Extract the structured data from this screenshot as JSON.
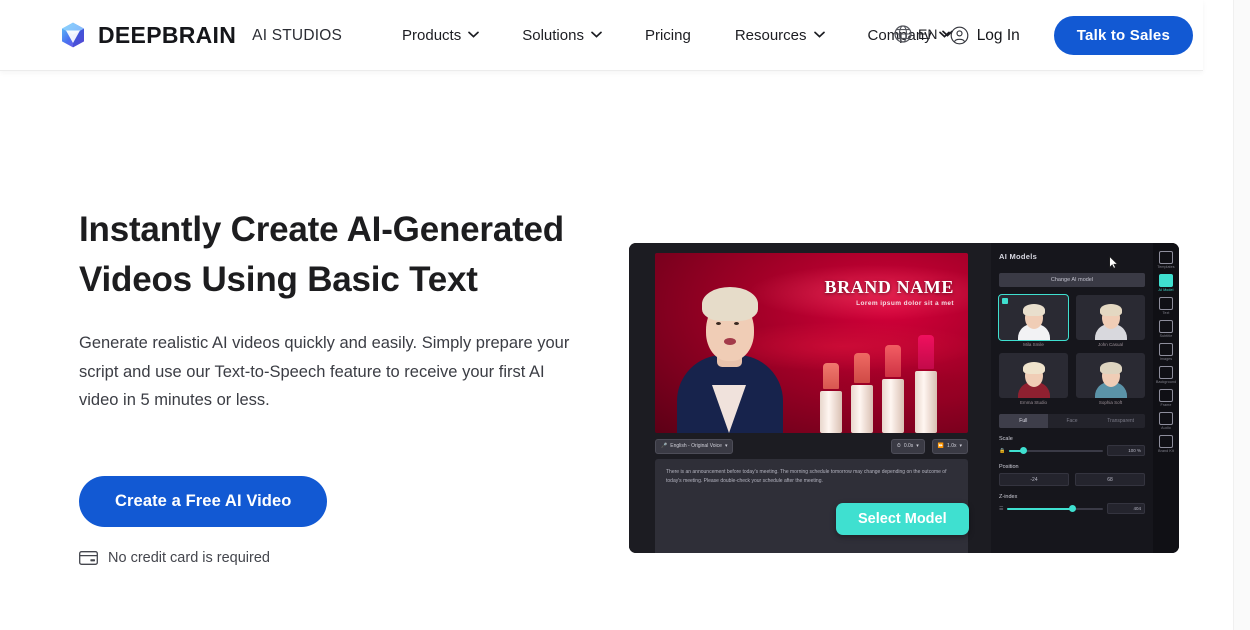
{
  "header": {
    "brand": {
      "name": "DEEPBRAIN",
      "suffix": "AI STUDIOS",
      "logo_icon": "cube-logo-icon"
    },
    "nav": [
      {
        "label": "Products",
        "has_dropdown": true
      },
      {
        "label": "Solutions",
        "has_dropdown": true
      },
      {
        "label": "Pricing",
        "has_dropdown": false
      },
      {
        "label": "Resources",
        "has_dropdown": true
      },
      {
        "label": "Company",
        "has_dropdown": true
      }
    ],
    "language": {
      "label": "EN",
      "icon": "globe-icon"
    },
    "login": {
      "label": "Log In",
      "icon": "user-circle-icon"
    },
    "cta": {
      "label": "Talk to Sales"
    }
  },
  "hero": {
    "heading": "Instantly Create AI-Generated Videos Using Basic Text",
    "paragraph": "Generate realistic AI videos quickly and easily. Simply prepare your script and use our Text-to-Speech feature to receive your first AI video in 5 minutes or less.",
    "cta_label": "Create a Free AI Video",
    "note": "No credit card is required",
    "note_icon": "credit-card-icon"
  },
  "mockup": {
    "video": {
      "brand_title": "BRAND NAME",
      "brand_subtitle": "Lorem ipsum dolor sit a met"
    },
    "toolbar": {
      "language_pill": "English - Original Voice",
      "duration": "0.0s",
      "speed": "1.0x"
    },
    "script": "There is an announcement before today's meeting. The morning schedule tomorrow may change depending on the outcome of today's meeting. Please double-check your schedule after the meeting.",
    "select_model_label": "Select Model",
    "panel": {
      "title": "AI Models",
      "change_button": "Change AI model",
      "avatars": [
        {
          "label": "Mila Smile",
          "selected": true
        },
        {
          "label": "John Casual",
          "selected": false
        },
        {
          "label": "Emma Studio",
          "selected": false
        },
        {
          "label": "Sophia Soft",
          "selected": false
        }
      ],
      "segments": [
        {
          "label": "Full",
          "active": true
        },
        {
          "label": "Face",
          "active": false
        },
        {
          "label": "Transparent",
          "active": false
        }
      ],
      "controls": [
        {
          "name": "Scale",
          "value": "100 %"
        },
        {
          "name": "Position",
          "x": "-24",
          "y": "68"
        },
        {
          "name": "Z-index",
          "value": "404"
        }
      ]
    },
    "vtools": [
      {
        "label": "Templates",
        "icon": "template-icon",
        "active": false
      },
      {
        "label": "AI Model",
        "icon": "person-icon",
        "active": true
      },
      {
        "label": "Text",
        "icon": "text-icon",
        "active": false
      },
      {
        "label": "Subtitle",
        "icon": "subtitle-icon",
        "active": false
      },
      {
        "label": "Images",
        "icon": "image-icon",
        "active": false
      },
      {
        "label": "Background",
        "icon": "background-icon",
        "active": false
      },
      {
        "label": "Frame",
        "icon": "frame-icon",
        "active": false
      },
      {
        "label": "Audio",
        "icon": "audio-icon",
        "active": false
      },
      {
        "label": "Brand Kit",
        "icon": "brandkit-icon",
        "active": false
      }
    ],
    "cursor_icon": "mouse-pointer-icon"
  },
  "colors": {
    "primary_blue": "#1259d3",
    "accent_teal": "#3fe0d0",
    "text_dark": "#1d1d1f",
    "page_bg": "#ffffff"
  }
}
